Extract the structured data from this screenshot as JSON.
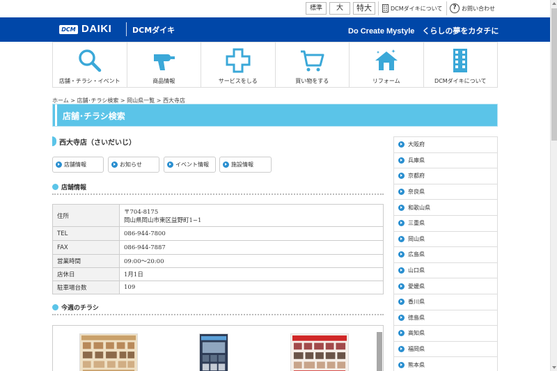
{
  "topbar": {
    "font_sizes": [
      "標準",
      "大",
      "特大"
    ],
    "about_label": "DCMダイキについて",
    "contact_label": "お問い合わせ"
  },
  "header": {
    "logo_badge": "DCM",
    "logo_text": "DAIKI",
    "brand_text": "DCMダイキ",
    "tagline": "Do Create Mystyle　くらしの夢をカタチに",
    "bg_color": "#0047a8"
  },
  "nav": [
    {
      "label": "店舗・チラシ・イベント",
      "icon": "search-icon"
    },
    {
      "label": "商品情報",
      "icon": "drill-icon"
    },
    {
      "label": "サービスをしる",
      "icon": "plus-icon"
    },
    {
      "label": "買い物をする",
      "icon": "cart-icon"
    },
    {
      "label": "リフォーム",
      "icon": "house-icon"
    },
    {
      "label": "DCMダイキについて",
      "icon": "building-icon"
    }
  ],
  "breadcrumb": "ホーム > 店舗･チラシ検索 > 岡山県一覧 > 西大寺店",
  "banner_title": "店舗･チラシ検索",
  "store_name": "西大寺店（さいだいじ）",
  "tabs": [
    "店舗情報",
    "お知らせ",
    "イベント情報",
    "施設情報"
  ],
  "section_info": "店舗情報",
  "section_flyer": "今週のチラシ",
  "info": {
    "address_label": "住所",
    "postal": "〒704-8175",
    "address": "岡山県岡山市東区益野町1−1",
    "tel_label": "TEL",
    "tel": "086-944-7800",
    "fax_label": "FAX",
    "fax": "086-944-7887",
    "hours_label": "営業時間",
    "hours": "09:00～20:00",
    "closed_label": "店休日",
    "closed": "1月1日",
    "parking_label": "駐車場台数",
    "parking": "109"
  },
  "prefectures": [
    "大阪府",
    "兵庫県",
    "京都府",
    "奈良県",
    "和歌山県",
    "三重県",
    "岡山県",
    "広島県",
    "山口県",
    "愛媛県",
    "香川県",
    "徳島県",
    "高知県",
    "福岡県",
    "熊本県"
  ],
  "accent_color": "#5bc4e8",
  "icon_color": "#3ba8d8"
}
